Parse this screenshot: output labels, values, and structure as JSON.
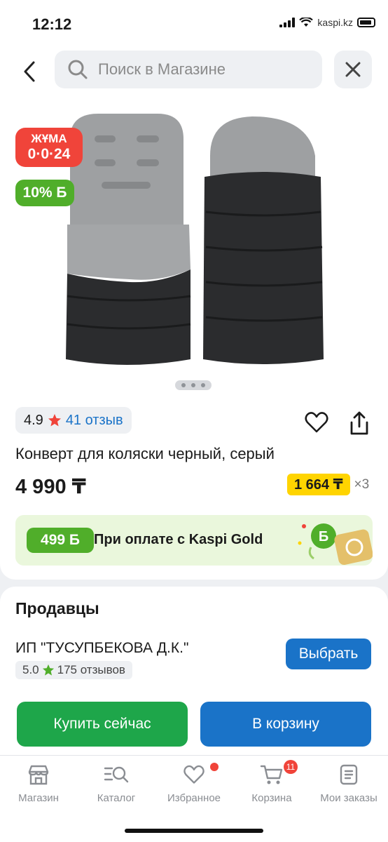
{
  "status_bar": {
    "time": "12:12",
    "watermark": "kaspi.kz"
  },
  "search": {
    "placeholder": "Поиск в Магазине"
  },
  "product": {
    "badge_sale": [
      "ЖҰМА",
      "0·0·24"
    ],
    "badge_bonus": "10% Б",
    "gallery": {
      "slides": 3,
      "active_slide": 1,
      "colors": {
        "dark": "#2b2c2e",
        "light": "#9ea0a2"
      }
    },
    "rating": {
      "value": "4.9",
      "reviews": "41 отзыв"
    },
    "title": "Конверт для коляски черный, серый",
    "price": "4 990 ₸",
    "installment": {
      "amount": "1 664 ₸",
      "multiplier": "×3"
    },
    "kaspi_gold": {
      "bonus": "499 Б",
      "text": "При оплате с Kaspi Gold"
    }
  },
  "sellers": {
    "heading": "Продавцы",
    "items": [
      {
        "name": "ИП \"ТУСУПБЕКОВА Д.К.\"",
        "rating": "5.0",
        "reviews": "175 отзывов",
        "action": "Выбрать"
      }
    ]
  },
  "actions": {
    "buy_now": "Купить сейчас",
    "add_to_cart": "В корзину"
  },
  "tabbar": {
    "items": [
      {
        "label": "Магазин",
        "icon": "store-icon"
      },
      {
        "label": "Каталог",
        "icon": "catalog-search-icon"
      },
      {
        "label": "Избранное",
        "icon": "heart-icon",
        "has_dot": true
      },
      {
        "label": "Корзина",
        "icon": "cart-icon",
        "count": "11"
      },
      {
        "label": "Мои заказы",
        "icon": "orders-icon"
      }
    ]
  },
  "colors": {
    "kaspi_red": "#f0443a",
    "kaspi_blue": "#1a73c8",
    "kaspi_green": "#1ea64a",
    "installment_yellow": "#ffd400"
  }
}
